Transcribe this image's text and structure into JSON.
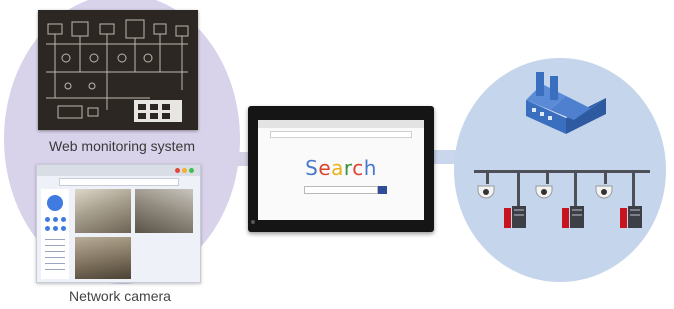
{
  "labels": {
    "web_monitoring": "Web monitoring system",
    "network_camera": "Network camera"
  },
  "tablet": {
    "search_word": "Search",
    "search_letter_colors": [
      "#4a78c9",
      "#d9452f",
      "#e7b21c",
      "#3a8f3f",
      "#d9452f",
      "#4a78c9"
    ]
  },
  "colors": {
    "left_circle": "#d8d2ea",
    "right_circle": "#c5d5ec",
    "factory": "#3a6fc0",
    "camera_dot": "#3f7be0"
  },
  "icons": [
    "schematic-panel",
    "browser-window",
    "tablet",
    "factory-icon",
    "dome-camera-icon",
    "plc-unit-icon"
  ]
}
